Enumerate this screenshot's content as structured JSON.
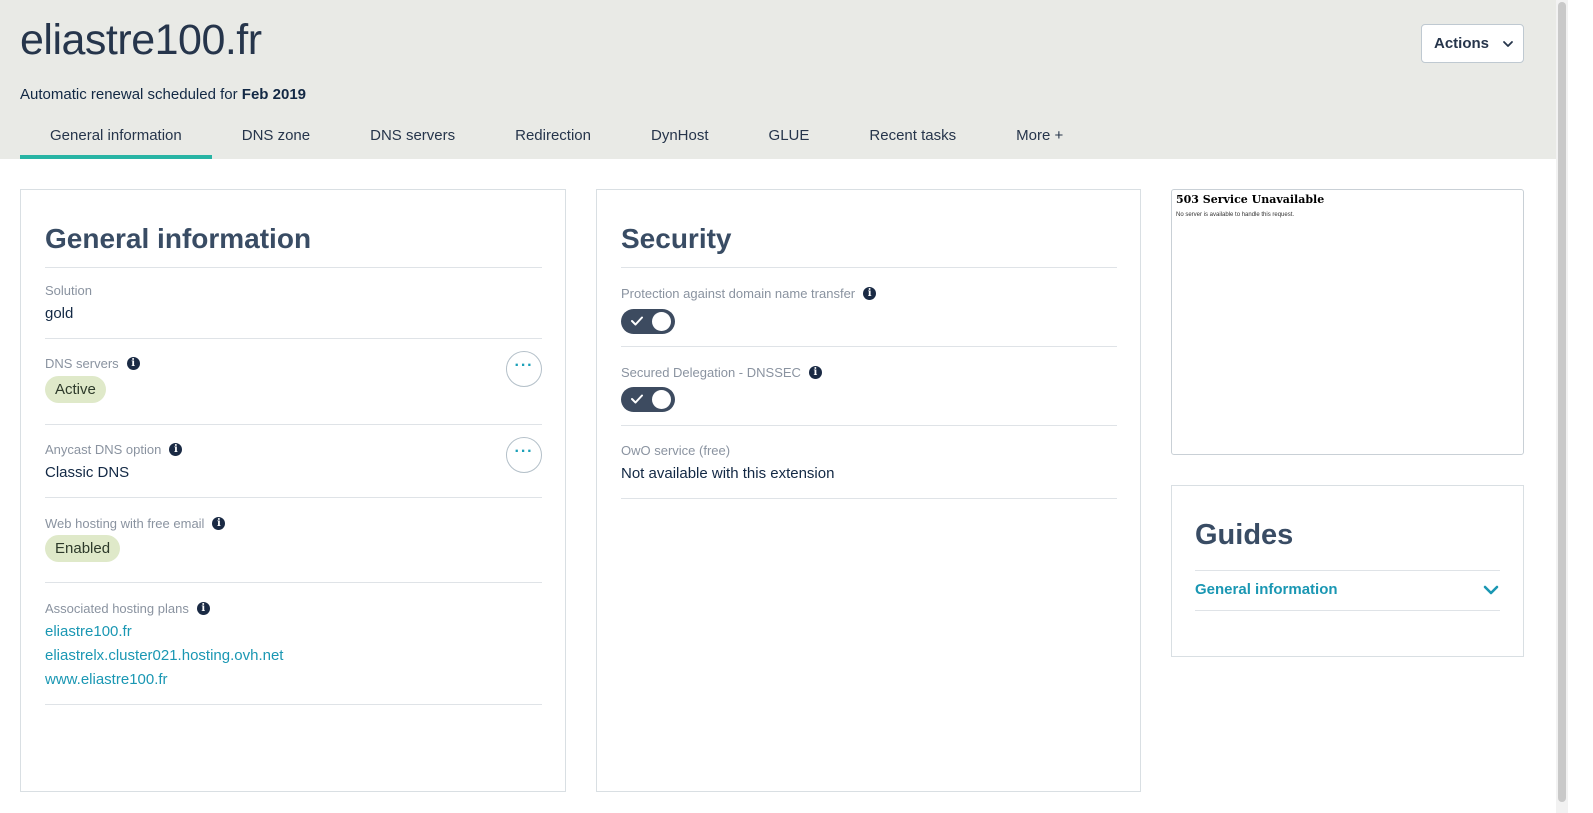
{
  "header": {
    "domain": "eliastre100.fr",
    "renewal_prefix": "Automatic renewal scheduled for ",
    "renewal_date": "Feb 2019",
    "actions_label": "Actions"
  },
  "tabs": [
    {
      "label": "General information"
    },
    {
      "label": "DNS zone"
    },
    {
      "label": "DNS servers"
    },
    {
      "label": "Redirection"
    },
    {
      "label": "DynHost"
    },
    {
      "label": "GLUE"
    },
    {
      "label": "Recent tasks"
    },
    {
      "label": "More +"
    }
  ],
  "general": {
    "title": "General information",
    "solution_label": "Solution",
    "solution_value": "gold",
    "dns_servers_label": "DNS servers",
    "dns_servers_status": "Active",
    "anycast_label": "Anycast DNS option",
    "anycast_value": "Classic DNS",
    "web_hosting_label": "Web hosting with free email",
    "web_hosting_status": "Enabled",
    "hosting_plans_label": "Associated hosting plans",
    "hosting_plans": [
      "eliastre100.fr",
      "eliastrelx.cluster021.hosting.ovh.net",
      "www.eliastre100.fr"
    ]
  },
  "security": {
    "title": "Security",
    "transfer_label": "Protection against domain name transfer",
    "dnssec_label": "Secured Delegation - DNSSEC",
    "owo_label": "OwO service (free)",
    "owo_value": "Not available with this extension"
  },
  "preview": {
    "title": "503 Service Unavailable",
    "text": "No server is available to handle this request."
  },
  "guides": {
    "title": "Guides",
    "item": "General information"
  },
  "colors": {
    "header_bg": "#e9eae6",
    "accent_tab": "#28b4a4",
    "link": "#1a97b3",
    "badge_bg": "#dfe9c9",
    "toggle_bg": "#3d4b60"
  }
}
